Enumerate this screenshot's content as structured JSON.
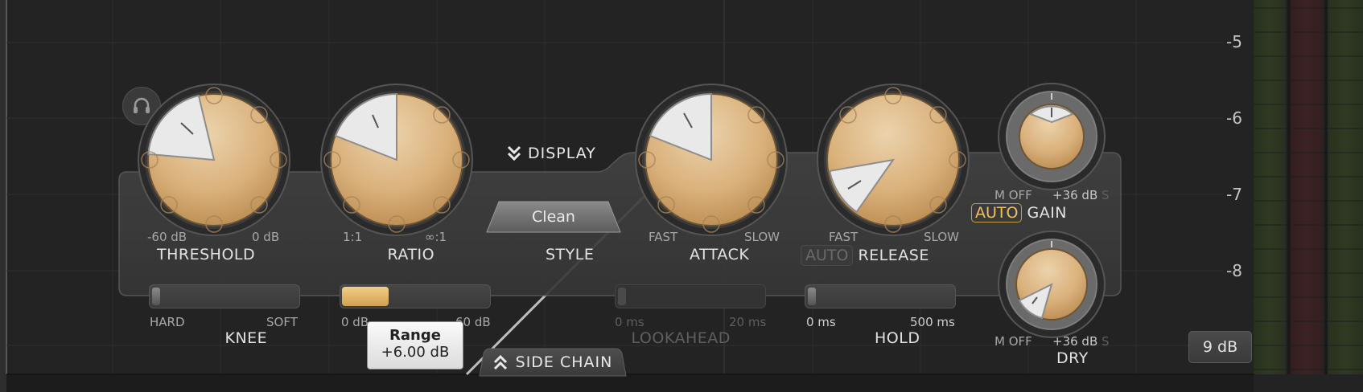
{
  "scale": {
    "ticks": [
      "-5",
      "-6",
      "-7",
      "-8"
    ]
  },
  "threshold": {
    "label": "THRESHOLD",
    "min_label": "-60 dB",
    "max_label": "0 dB"
  },
  "ratio": {
    "label": "RATIO",
    "min_label": "1:1",
    "max_label": "∞:1"
  },
  "style": {
    "label": "STYLE",
    "value": "Clean"
  },
  "display": {
    "label": "DISPLAY"
  },
  "attack": {
    "label": "ATTACK",
    "min_label": "FAST",
    "max_label": "SLOW"
  },
  "release": {
    "label": "RELEASE",
    "auto_label": "AUTO",
    "min_label": "FAST",
    "max_label": "SLOW"
  },
  "gain": {
    "auto_label": "AUTO",
    "label": "GAIN",
    "min_label": "M OFF",
    "max_label": "+36 dB",
    "side_label": "S"
  },
  "dry": {
    "label": "DRY",
    "min_label": "M OFF",
    "max_label": "+36 dB",
    "side_label": "S"
  },
  "knee": {
    "label": "KNEE",
    "min_label": "HARD",
    "max_label": "SOFT"
  },
  "range": {
    "min_label": "0 dB",
    "max_label": "60 dB",
    "tooltip_title": "Range",
    "tooltip_value": "+6.00 dB",
    "fill_fraction": 0.1
  },
  "lookahead": {
    "label": "LOOKAHEAD",
    "min_label": "0 ms",
    "max_label": "20 ms",
    "enabled": false
  },
  "hold": {
    "label": "HOLD",
    "min_label": "0 ms",
    "max_label": "500 ms"
  },
  "side_chain": {
    "label": "SIDE CHAIN"
  },
  "meter_range": {
    "label": "9 dB"
  },
  "icons": {
    "solo": "headphones-icon",
    "display_toggle": "chevron-double-down-icon",
    "side_chain_toggle": "chevron-double-up-icon"
  },
  "colors": {
    "knob_gold": "#d9b07a",
    "accent_auto": "#f0c060",
    "background": "#222223"
  }
}
